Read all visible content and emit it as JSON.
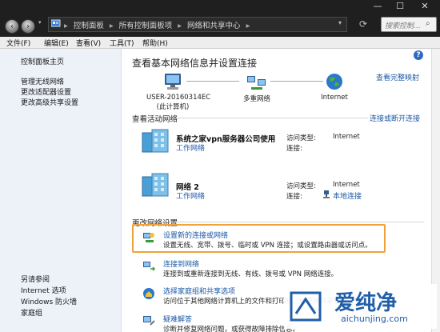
{
  "window": {
    "controls": {
      "minimize": "—",
      "maximize": "☐",
      "close": "✕"
    }
  },
  "address": {
    "back_glyph": "‹",
    "forward_glyph": "›",
    "crumbs": [
      "控制面板",
      "所有控制面板项",
      "网络和共享中心"
    ],
    "separator": "▸",
    "search_placeholder": "搜索控制…"
  },
  "menu": [
    "文件(F)",
    "编辑(E)",
    "查看(V)",
    "工具(T)",
    "帮助(H)"
  ],
  "sidebar": {
    "home": "控制面板主页",
    "links": [
      "管理无线网络",
      "更改适配器设置",
      "更改高级共享设置"
    ],
    "see_also_title": "另请参阅",
    "see_also": [
      "Internet 选项",
      "Windows 防火墙",
      "家庭组"
    ]
  },
  "main": {
    "heading": "查看基本网络信息并设置连接",
    "full_map": "查看完整映射",
    "map": [
      {
        "line1": "USER-20160314EC",
        "line2": "(此计算机)",
        "icon": "computer-icon"
      },
      {
        "line1": "多重网络",
        "line2": "",
        "icon": "network-icon"
      },
      {
        "line1": "Internet",
        "line2": "",
        "icon": "globe-icon"
      }
    ],
    "active_title": "查看活动网络",
    "connect_disconnect": "连接或断开连接",
    "networks": [
      {
        "name": "系统之家vpn服务器公司使用",
        "type_link": "工作网络",
        "access_label": "访问类型:",
        "access_value": "Internet",
        "conn_label": "连接:",
        "conn_value": "",
        "conn_link": ""
      },
      {
        "name": "网络  2",
        "type_link": "工作网络",
        "access_label": "访问类型:",
        "access_value": "Internet",
        "conn_label": "连接:",
        "conn_value": "",
        "conn_link": "本地连接"
      }
    ],
    "change_title": "更改网络设置",
    "tasks": [
      {
        "title": "设置新的连接或网络",
        "desc": "设置无线、宽带、拨号、临时或 VPN 连接；或设置路由器或访问点。"
      },
      {
        "title": "连接到网络",
        "desc": "连接到或重新连接到无线、有线、拨号或 VPN 网络连接。"
      },
      {
        "title": "选择家庭组和共享选项",
        "desc": "访问位于其他网络计算机上的文件和打印机，或更改共享设置。"
      },
      {
        "title": "疑难解答",
        "desc": "诊断并修复网络问题，或获得故障排除信息。"
      }
    ]
  },
  "watermark": {
    "brand": "爱纯净",
    "url": "aichunjing.com"
  },
  "colors": {
    "titlebar": "#1f1f1f",
    "link": "#1b58a6",
    "highlight_border": "#f0a23a",
    "sidebar_bg": "#edf1f8"
  }
}
